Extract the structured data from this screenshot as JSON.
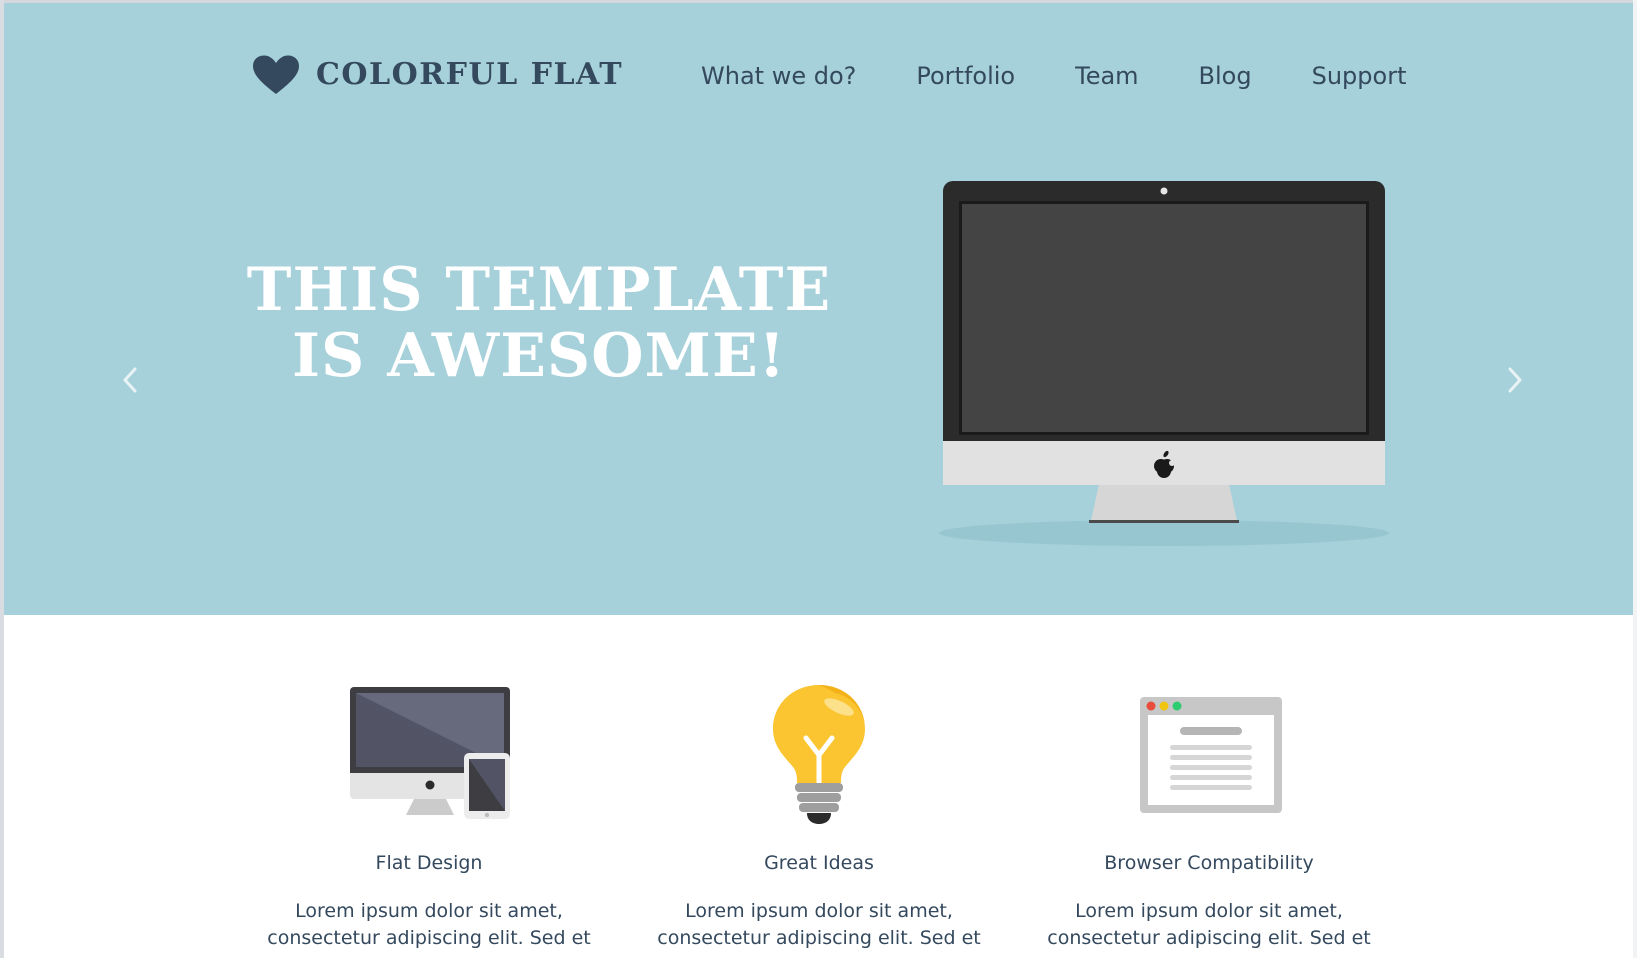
{
  "brand": {
    "name": "COLORFUL FLAT",
    "logo_icon": "heart-icon"
  },
  "nav": {
    "items": [
      {
        "label": "What we do?"
      },
      {
        "label": "Portfolio"
      },
      {
        "label": "Team"
      },
      {
        "label": "Blog"
      },
      {
        "label": "Support"
      }
    ]
  },
  "hero": {
    "headline_line1": "THIS TEMPLATE",
    "headline_line2": "IS AWESOME!",
    "prev_icon": "chevron-left-icon",
    "next_icon": "chevron-right-icon",
    "image": "monitor-illustration"
  },
  "features": [
    {
      "icon": "devices-icon",
      "title": "Flat Design",
      "text_line1": "Lorem ipsum dolor sit amet,",
      "text_line2": "consectetur adipiscing elit. Sed et"
    },
    {
      "icon": "lightbulb-icon",
      "title": "Great Ideas",
      "text_line1": "Lorem ipsum dolor sit amet,",
      "text_line2": "consectetur adipiscing elit. Sed et"
    },
    {
      "icon": "browser-window-icon",
      "title": "Browser Compatibility",
      "text_line1": "Lorem ipsum dolor sit amet,",
      "text_line2": "consectetur adipiscing elit. Sed et"
    }
  ],
  "colors": {
    "hero_background": "#a6d1da",
    "text_dark": "#34495e",
    "headline": "#ffffff",
    "lightbulb": "#fbc531",
    "dot_red": "#e74c3c",
    "dot_yellow": "#f1c40f",
    "dot_green": "#2ecc71"
  }
}
